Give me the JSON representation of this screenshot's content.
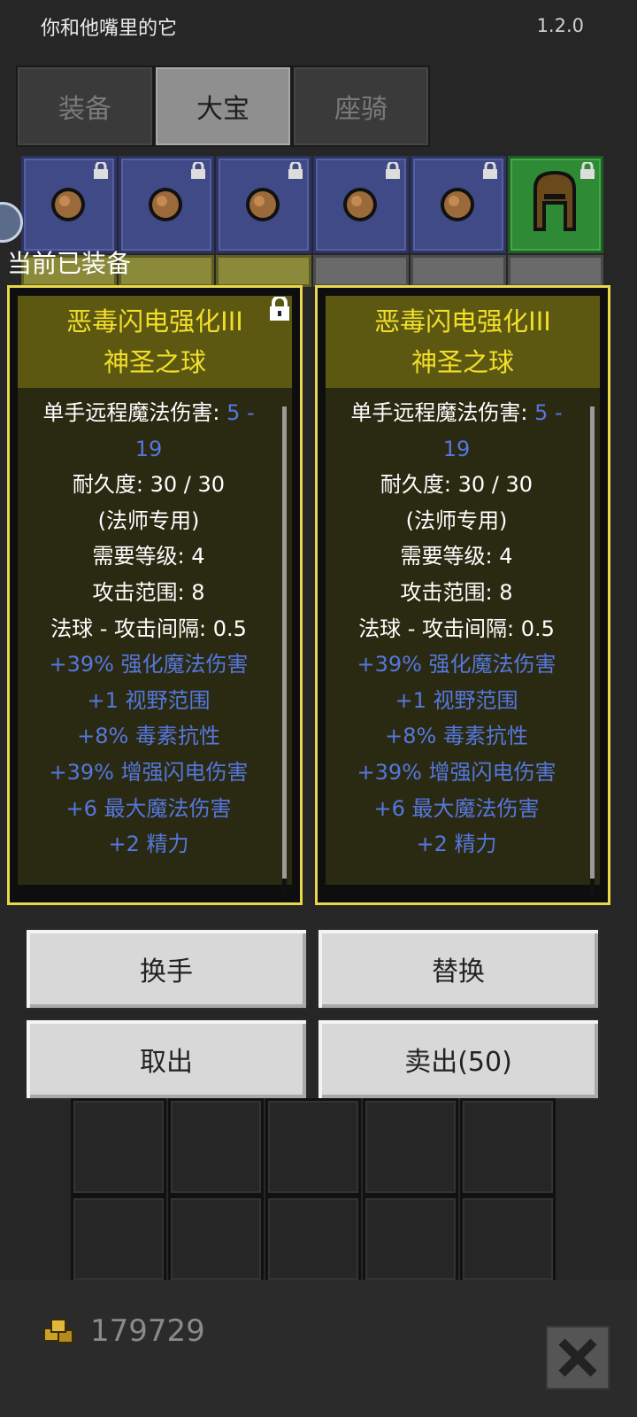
{
  "header": {
    "app_title": "你和他嘴里的它",
    "version": "1.2.0"
  },
  "tabs": [
    {
      "label": "装备",
      "active": false
    },
    {
      "label": "大宝",
      "active": true
    },
    {
      "label": "座骑",
      "active": false
    }
  ],
  "equipped_label": "当前已装备",
  "cards": [
    {
      "name_line1": "恶毒闪电强化III",
      "name_line2": "神圣之球",
      "locked": true,
      "stats": [
        {
          "text": "单手远程魔法伤害: ",
          "suffix": "5 -",
          "style": "white"
        },
        {
          "text": "19",
          "style": "blue"
        },
        {
          "text": "耐久度: 30 / 30",
          "style": "white"
        },
        {
          "text": "(法师专用)",
          "style": "white"
        },
        {
          "text": "需要等级: 4",
          "style": "white"
        },
        {
          "text": "攻击范围: 8",
          "style": "white"
        },
        {
          "text": "法球 - 攻击间隔: 0.5",
          "style": "white"
        },
        {
          "text": "+39% 强化魔法伤害",
          "style": "blue"
        },
        {
          "text": "+1 视野范围",
          "style": "blue"
        },
        {
          "text": "+8% 毒素抗性",
          "style": "blue"
        },
        {
          "text": "+39% 增强闪电伤害",
          "style": "blue"
        },
        {
          "text": "+6 最大魔法伤害",
          "style": "blue"
        },
        {
          "text": "+2 精力",
          "style": "blue"
        }
      ]
    },
    {
      "name_line1": "恶毒闪电强化III",
      "name_line2": "神圣之球",
      "locked": false,
      "stats": [
        {
          "text": "单手远程魔法伤害: ",
          "suffix": "5 -",
          "style": "white"
        },
        {
          "text": "19",
          "style": "blue"
        },
        {
          "text": "耐久度: 30 / 30",
          "style": "white"
        },
        {
          "text": "(法师专用)",
          "style": "white"
        },
        {
          "text": "需要等级: 4",
          "style": "white"
        },
        {
          "text": "攻击范围: 8",
          "style": "white"
        },
        {
          "text": "法球 - 攻击间隔: 0.5",
          "style": "white"
        },
        {
          "text": "+39% 强化魔法伤害",
          "style": "blue"
        },
        {
          "text": "+1 视野范围",
          "style": "blue"
        },
        {
          "text": "+8% 毒素抗性",
          "style": "blue"
        },
        {
          "text": "+39% 增强闪电伤害",
          "style": "blue"
        },
        {
          "text": "+6 最大魔法伤害",
          "style": "blue"
        },
        {
          "text": "+2 精力",
          "style": "blue"
        }
      ]
    }
  ],
  "buttons": {
    "swap_hand": "换手",
    "replace": "替换",
    "take_out": "取出",
    "sell": "卖出(50)"
  },
  "gold": "179729",
  "icons": {
    "slot_item": "orb-icon",
    "helmet": "helmet-icon",
    "lock": "lock-icon",
    "gold": "gold-coins-icon",
    "close": "close-icon"
  },
  "colors": {
    "title_gold": "#f2df2a",
    "stat_blue": "#5577dd",
    "card_border": "#e8d84a"
  }
}
